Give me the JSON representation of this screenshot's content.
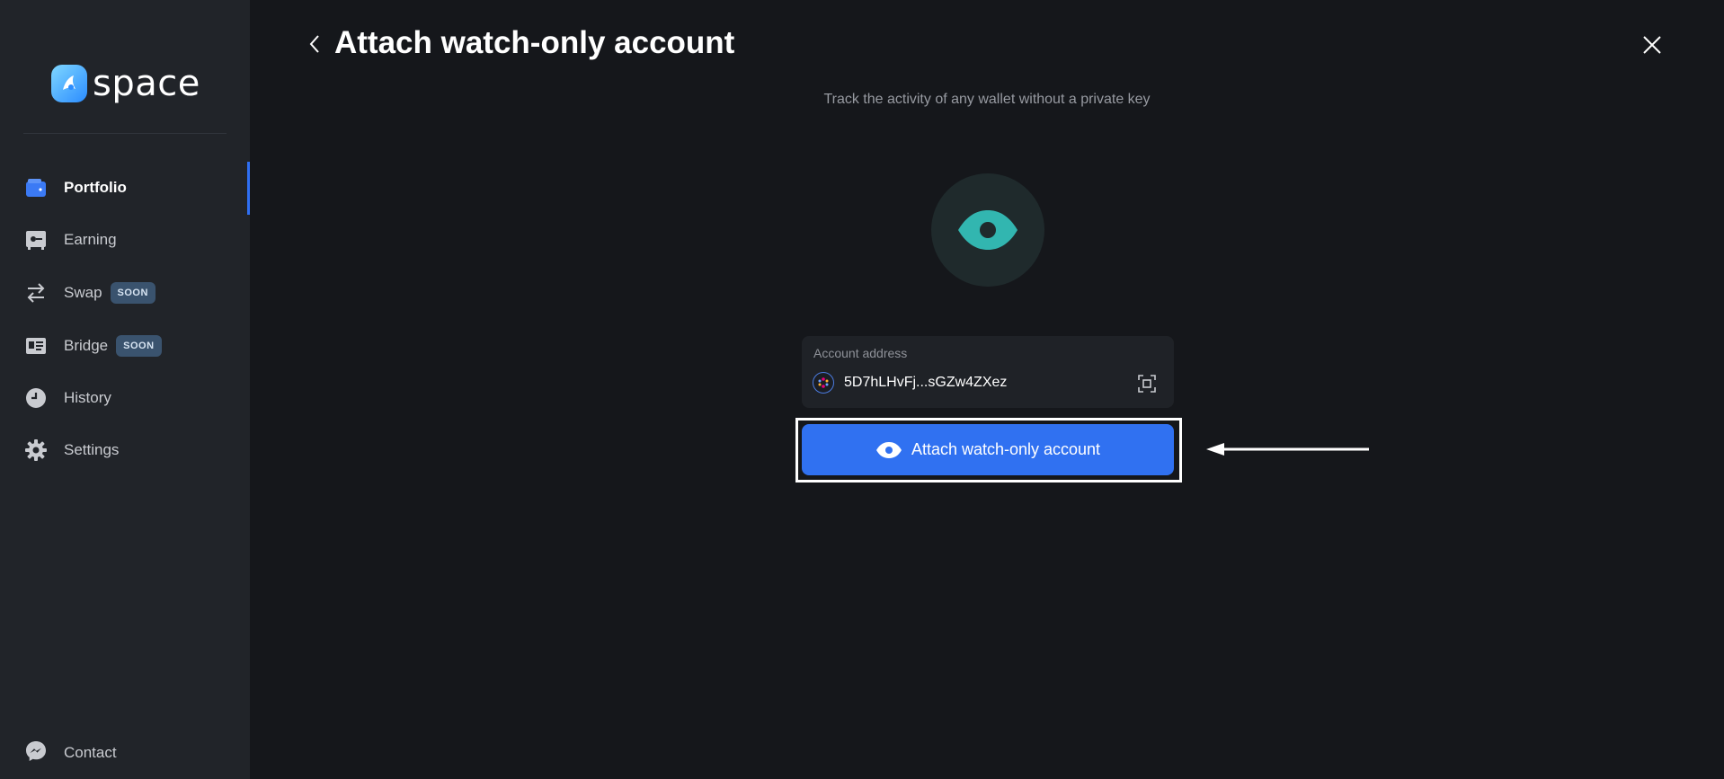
{
  "app": {
    "brand": "space"
  },
  "sidebar": {
    "items": [
      {
        "label": "Portfolio",
        "icon": "wallet-icon",
        "active": true
      },
      {
        "label": "Earning",
        "icon": "safe-icon"
      },
      {
        "label": "Swap",
        "icon": "swap-arrows-icon",
        "badge": "SOON"
      },
      {
        "label": "Bridge",
        "icon": "bridge-card-icon",
        "badge": "SOON"
      },
      {
        "label": "History",
        "icon": "clock-icon"
      },
      {
        "label": "Settings",
        "icon": "gear-icon"
      }
    ],
    "contact": {
      "label": "Contact",
      "icon": "messenger-icon"
    }
  },
  "header": {
    "title": "Attach watch-only account"
  },
  "main": {
    "subtitle": "Track the activity of any wallet without a private key",
    "hero_icon": "eye-icon",
    "address_field": {
      "label": "Account address",
      "value": "5D7hLHvFj...sGZw4ZXez"
    },
    "submit_label": "Attach watch-only account"
  },
  "colors": {
    "accent": "#3071f1",
    "hero": "#32b6b0",
    "sidebar_bg": "#212429",
    "page_bg": "#15171b",
    "badge_bg": "#3a536e"
  }
}
